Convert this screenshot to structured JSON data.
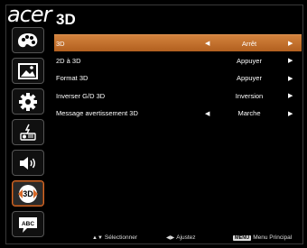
{
  "brand": {
    "logo": "acer"
  },
  "page_title": "3D",
  "sidebar": {
    "items": [
      {
        "icon": "palette-icon",
        "active": false
      },
      {
        "icon": "image-icon",
        "active": false
      },
      {
        "icon": "gear-icon",
        "active": false
      },
      {
        "icon": "projector-icon",
        "active": false
      },
      {
        "icon": "speaker-icon",
        "active": false
      },
      {
        "icon": "3d-icon",
        "label": "3D",
        "active": true
      },
      {
        "icon": "language-icon",
        "label": "ABC",
        "active": false
      }
    ]
  },
  "menu": {
    "rows": [
      {
        "label": "3D",
        "value": "Arrêt",
        "left_arrow": true,
        "right_arrow": true,
        "selected": true
      },
      {
        "label": "2D à 3D",
        "value": "Appuyer",
        "left_arrow": false,
        "right_arrow": true,
        "selected": false
      },
      {
        "label": "Format 3D",
        "value": "Appuyer",
        "left_arrow": false,
        "right_arrow": true,
        "selected": false
      },
      {
        "label": "Inverser G/D 3D",
        "value": "Inversion",
        "left_arrow": false,
        "right_arrow": true,
        "selected": false
      },
      {
        "label": "Message avertissement 3D",
        "value": "Marche",
        "left_arrow": true,
        "right_arrow": true,
        "selected": false
      }
    ]
  },
  "footer": {
    "select_label": "Sélectionner",
    "adjust_label": "Ajustez",
    "menu_key": "MENU",
    "main_menu_label": "Menu Principal"
  },
  "colors": {
    "accent": "#c8702e",
    "background": "#000000"
  }
}
